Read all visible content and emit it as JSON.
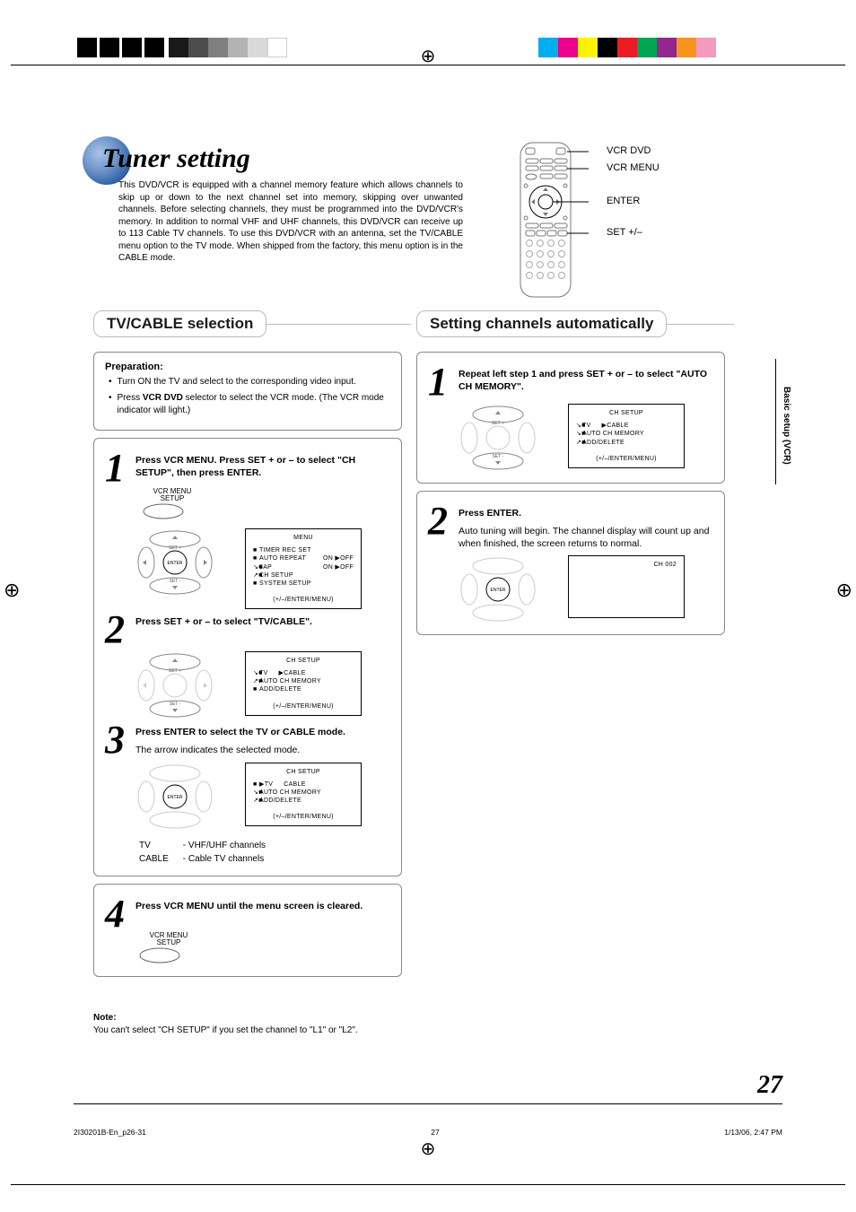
{
  "marks": {
    "grays": [
      "#000",
      "#000",
      "#000",
      "#000",
      "#1a1a1a",
      "#4d4d4d",
      "#808080",
      "#b3b3b3",
      "#d9d9d9",
      "#f2f2f2"
    ],
    "colors": [
      "#00aeef",
      "#ec008c",
      "#fff200",
      "#ed1c24",
      "#00a651",
      "#92278f",
      "#f7941d",
      "#f49ac1"
    ]
  },
  "side_tab": "Basic setup (VCR)",
  "title": "Tuner setting",
  "intro": "This DVD/VCR is equipped with a channel memory feature which allows channels to skip up or down to the next channel set into memory, skipping over unwanted channels. Before selecting channels, they must be programmed into the DVD/VCR's memory. In addition to normal VHF and UHF channels, this DVD/VCR can receive up to 113 Cable TV channels. To use this DVD/VCR with an antenna, set the TV/CABLE menu option to the TV mode. When shipped from the factory, this menu option is in the CABLE mode.",
  "remote_labels": {
    "l1": "VCR DVD",
    "l2": "VCR MENU",
    "l3": "ENTER",
    "l4": "SET +/–"
  },
  "left": {
    "heading": "TV/CABLE selection",
    "prep_title": "Preparation:",
    "prep_items": [
      {
        "pre": "Turn ON the TV and select to the corresponding video input."
      },
      {
        "pre": "Press ",
        "bold": "VCR DVD",
        "post": " selector to select the VCR mode. (The VCR mode indicator will light.)"
      }
    ],
    "step1": "Press VCR MENU. Press SET + or – to select \"CH SETUP\", then press ENTER.",
    "btn1_lbl": "VCR MENU\nSETUP",
    "osd1": {
      "title": "MENU",
      "rows": [
        {
          "mark": "■",
          "txt": "TIMER REC SET"
        },
        {
          "mark": "■",
          "txt": "AUTO REPEAT",
          "rmark": "▶",
          "rtxt": "OFF",
          "on": "ON"
        },
        {
          "mark": "↘■",
          "txt": "8AP",
          "rmark": "▶",
          "rtxt": "OFF",
          "on": "ON"
        },
        {
          "mark": "↗■",
          "txt": "CH SETUP"
        },
        {
          "mark": "■",
          "txt": "SYSTEM SETUP"
        }
      ],
      "foot": "(+/–/ENTER/MENU)"
    },
    "step2": "Press SET + or – to select \"TV/CABLE\".",
    "osd2": {
      "title": "CH SETUP",
      "rows": [
        {
          "mark": "↘■",
          "txt": "TV",
          "rmark": "▶",
          "rtxt": "CABLE"
        },
        {
          "mark": "↗■",
          "txt": "AUTO CH MEMORY"
        },
        {
          "mark": "■",
          "txt": "ADD/DELETE"
        }
      ],
      "foot": "(+/–/ENTER/MENU)"
    },
    "step3": "Press ENTER to select the TV or CABLE mode.",
    "step3_sub": "The arrow indicates the selected mode.",
    "osd3": {
      "title": "CH SETUP",
      "rows": [
        {
          "mark": "■",
          "pretxt": "▶",
          "txt": "TV",
          "rtxt": "CABLE"
        },
        {
          "mark": "↘■",
          "txt": "AUTO CH MEMORY"
        },
        {
          "mark": "↗■",
          "txt": "ADD/DELETE"
        }
      ],
      "foot": "(+/–/ENTER/MENU)"
    },
    "chtab": [
      [
        "TV",
        "- VHF/UHF channels"
      ],
      [
        "CABLE",
        "- Cable TV channels"
      ]
    ],
    "step4": "Press VCR MENU until the menu screen is cleared.",
    "btn4_lbl": "VCR MENU\nSETUP"
  },
  "right": {
    "heading": "Setting channels automatically",
    "step1": "Repeat left step 1 and press SET + or – to select \"AUTO CH MEMORY\".",
    "osd1": {
      "title": "CH SETUP",
      "rows": [
        {
          "mark": "↘■",
          "txt": "TV",
          "rmark": "▶",
          "rtxt": "CABLE"
        },
        {
          "mark": "↘■",
          "txt": "AUTO CH MEMORY"
        },
        {
          "mark": "↗■",
          "txt": "ADD/DELETE"
        }
      ],
      "foot": "(+/–/ENTER/MENU)"
    },
    "step2": "Press ENTER.",
    "step2_sub": "Auto tuning will begin. The channel display will count up and when finished, the screen returns to normal.",
    "osd2": {
      "title": "",
      "single": "CH 002"
    }
  },
  "note_title": "Note:",
  "note_body": "You can't select \"CH SETUP\" if you set the channel to \"L1\" or \"L2\".",
  "page_number": "27",
  "footer": {
    "file": "2I30201B-En_p26-31",
    "page": "27",
    "date": "1/13/06, 2:47 PM"
  }
}
